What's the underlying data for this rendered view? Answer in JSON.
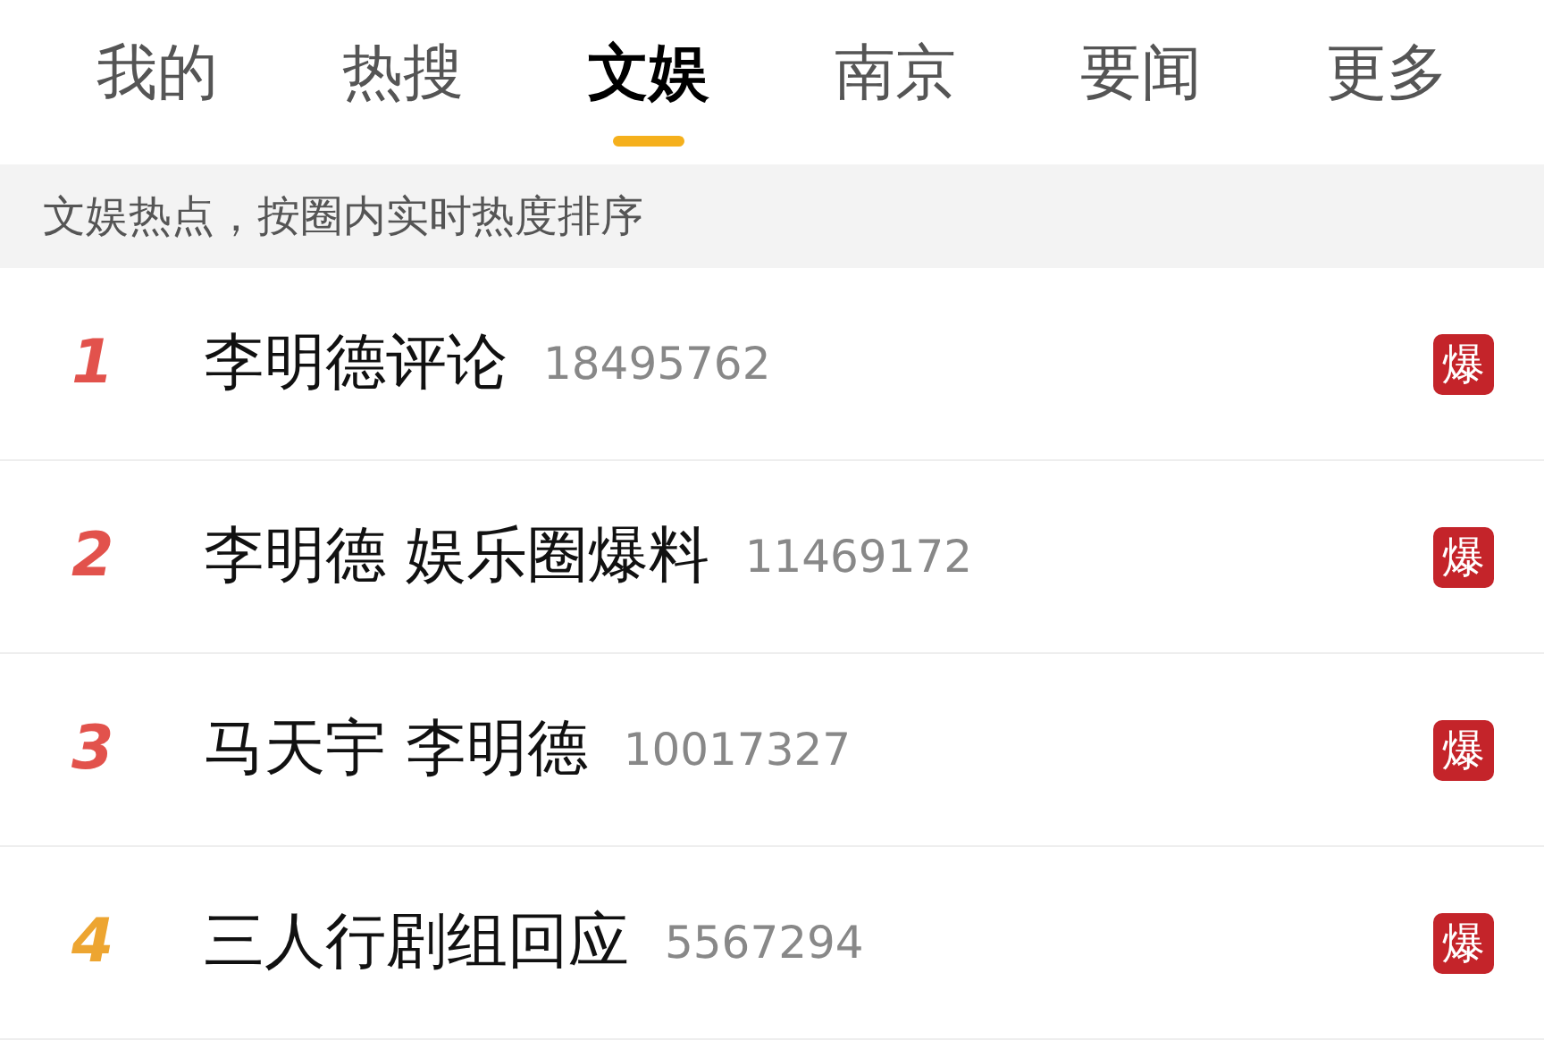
{
  "tabs": [
    {
      "label": "我的",
      "selected": false
    },
    {
      "label": "热搜",
      "selected": false
    },
    {
      "label": "文娱",
      "selected": true
    },
    {
      "label": "南京",
      "selected": false
    },
    {
      "label": "要闻",
      "selected": false
    },
    {
      "label": "更多",
      "selected": false
    }
  ],
  "section_note": "文娱热点，按圈内实时热度排序",
  "items": [
    {
      "rank": "1",
      "color": "#e2524c",
      "title": "李明德评论",
      "count": "18495762",
      "badge": "爆"
    },
    {
      "rank": "2",
      "color": "#e2524c",
      "title": "李明德 娱乐圈爆料",
      "count": "11469172",
      "badge": "爆"
    },
    {
      "rank": "3",
      "color": "#e2524c",
      "title": "马天宇 李明德",
      "count": "10017327",
      "badge": "爆"
    },
    {
      "rank": "4",
      "color": "#eda531",
      "title": "三人行剧组回应",
      "count": "5567294",
      "badge": "爆"
    }
  ]
}
